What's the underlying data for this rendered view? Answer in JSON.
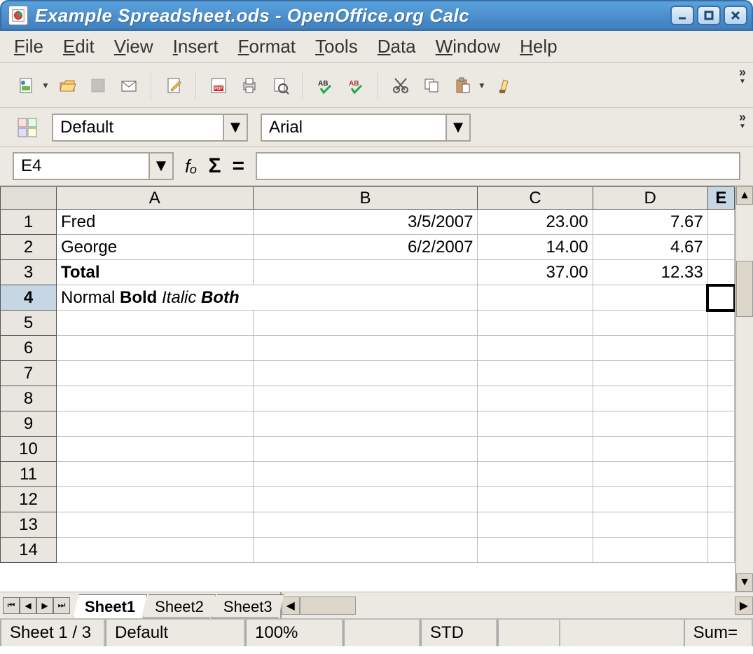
{
  "window": {
    "title": "Example Spreadsheet.ods - OpenOffice.org Calc"
  },
  "menu": [
    "File",
    "Edit",
    "View",
    "Insert",
    "Format",
    "Tools",
    "Data",
    "Window",
    "Help"
  ],
  "style_combo": "Default",
  "font_combo": "Arial",
  "cell_ref": "E4",
  "formula_value": "",
  "columns": [
    "A",
    "B",
    "C",
    "D",
    "E"
  ],
  "selected_col": "E",
  "selected_row": 4,
  "row_count": 14,
  "cells": {
    "A1": "Fred",
    "B1": "3/5/2007",
    "C1": "23.00",
    "D1": "7.67",
    "A2": "George",
    "B2": "6/2/2007",
    "C2": "14.00",
    "D2": "4.67",
    "A3": "Total",
    "C3": "37.00",
    "D3": "12.33",
    "A4_HTML": "Normal <b>Bold</b> <i>Italic</i> <b><i>Both</i></b>"
  },
  "sheet_tabs": [
    "Sheet1",
    "Sheet2",
    "Sheet3"
  ],
  "active_tab": "Sheet1",
  "status": {
    "sheet": "Sheet 1 / 3",
    "style": "Default",
    "zoom": "100%",
    "mode": "STD",
    "sum": "Sum="
  }
}
